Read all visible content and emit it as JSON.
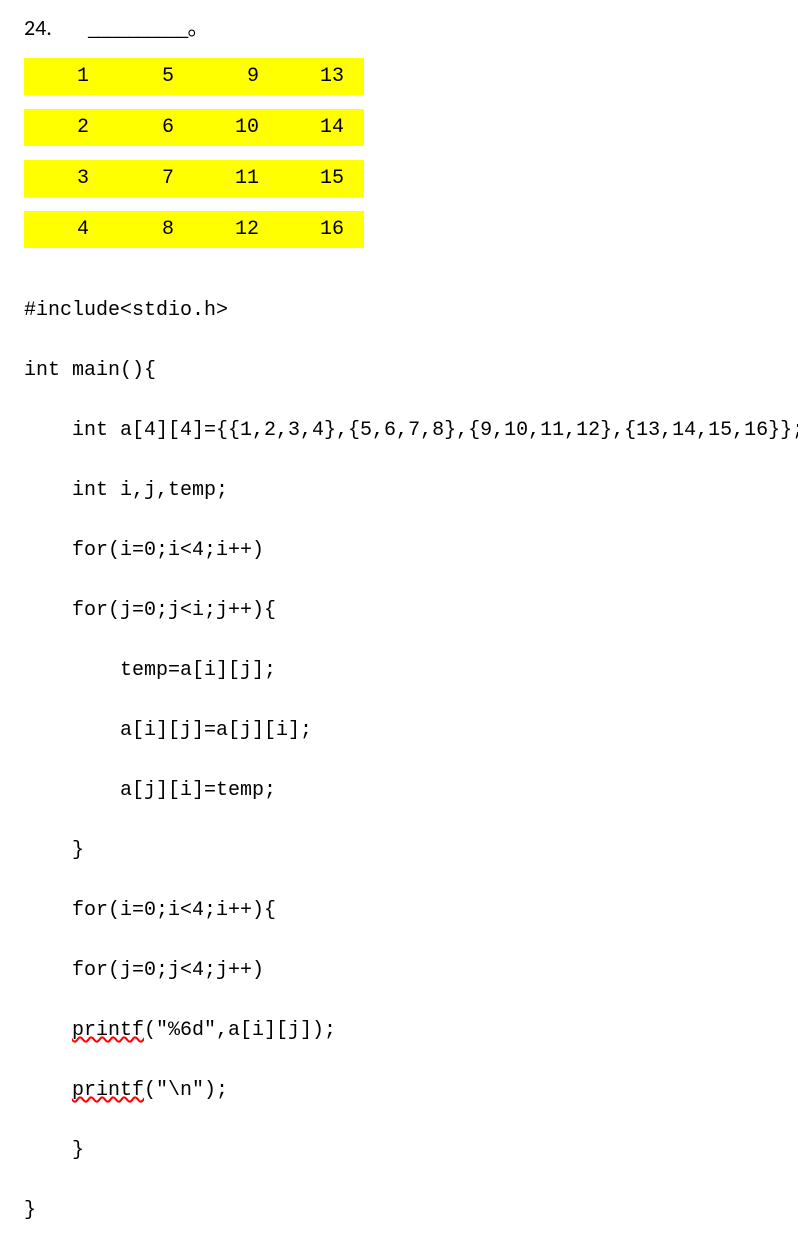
{
  "header": {
    "number": "24.",
    "blank": "__________",
    "suffix": "。"
  },
  "matrix": {
    "rows": [
      [
        "1",
        "5",
        "9",
        "13"
      ],
      [
        "2",
        "6",
        "10",
        "14"
      ],
      [
        "3",
        "7",
        "11",
        "15"
      ],
      [
        "4",
        "8",
        "12",
        "16"
      ]
    ]
  },
  "code": {
    "l1": "#include<stdio.h>",
    "l2": "int main(){",
    "l3": "    int a[4][4]={{1,2,3,4},{5,6,7,8},{9,10,11,12},{13,14,15,16}};",
    "l4": "    int i,j,temp;",
    "l5": "    for(i=0;i<4;i++)",
    "l6": "    for(j=0;j<i;j++){",
    "l7": "        temp=a[i][j];",
    "l8": "        a[i][j]=a[j][i];",
    "l9": "        a[j][i]=temp;",
    "l10": "    }",
    "l11": "    for(i=0;i<4;i++){",
    "l12": "    for(j=0;j<4;j++)",
    "l13_indent": "    ",
    "l13_func": "printf",
    "l13_rest": "(\"%6d\",a[i][j]);",
    "l14_indent": "    ",
    "l14_func": "printf",
    "l14_rest": "(\"\\n\");",
    "l15": "    }",
    "l16": "}"
  }
}
